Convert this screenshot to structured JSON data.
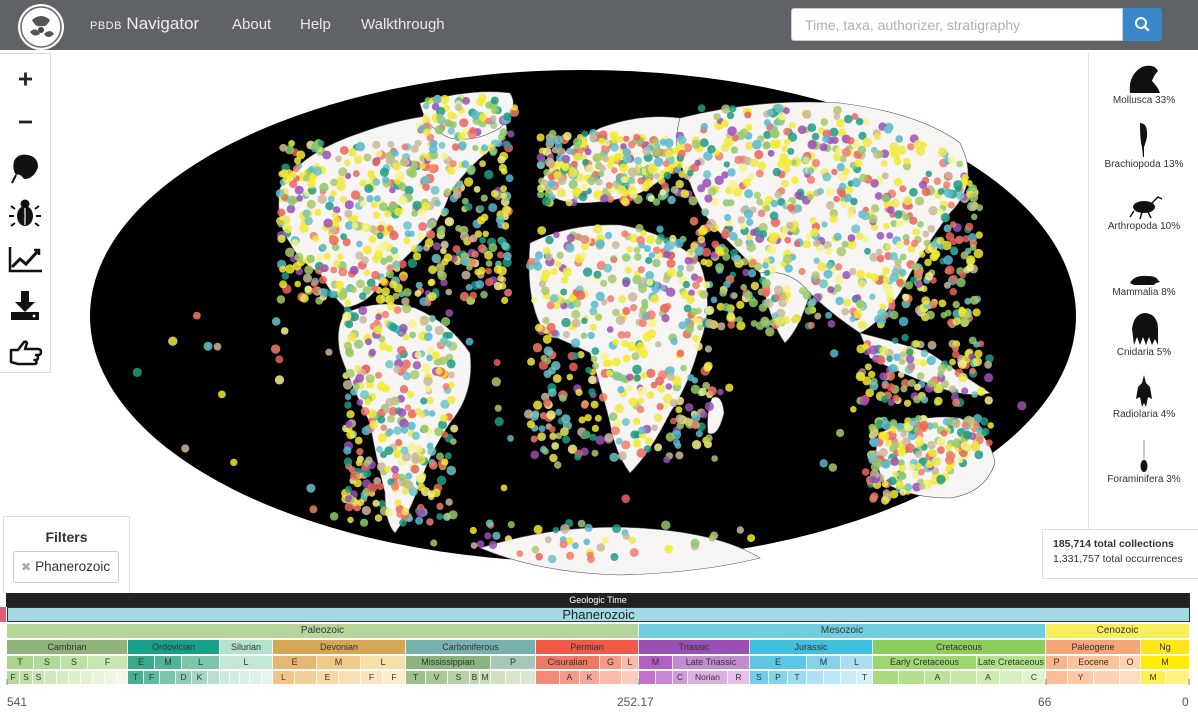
{
  "navbar": {
    "brand_small": "PBDB",
    "brand_big": "Navigator",
    "links": [
      "About",
      "Help",
      "Walkthrough"
    ],
    "search_placeholder": "Time, taxa, authorizer, stratigraphy"
  },
  "toolbar": {
    "tools": [
      "zoom-in",
      "zoom-out",
      "taxa-filter",
      "bug-filter",
      "diversity-chart",
      "download",
      "pointer"
    ]
  },
  "taxa": [
    {
      "label": "Mollusca 33%"
    },
    {
      "label": "Brachiopoda 13%"
    },
    {
      "label": "Arthropoda 10%"
    },
    {
      "label": "Mammalia 8%"
    },
    {
      "label": "Cnidaria 5%"
    },
    {
      "label": "Radiolaria 4%"
    },
    {
      "label": "Foraminifera 3%"
    }
  ],
  "filters": {
    "title": "Filters",
    "active": "Phanerozoic"
  },
  "stats": {
    "collections": "185,714",
    "collections_label": "total collections",
    "occurrences": "1,331,757",
    "occurrences_label": "total occurrences"
  },
  "timeline": {
    "header": "Geologic Time",
    "eon": "Phanerozoic",
    "eras": [
      "Paleozoic",
      "Mesozoic",
      "Cenozoic"
    ],
    "periods": [
      "Cambrian",
      "Ordovician",
      "Silurian",
      "Devonian",
      "Carboniferous",
      "Permian",
      "Triassic",
      "Jurassic",
      "Cretaceous",
      "Paleogene",
      "Ng"
    ],
    "subperiods": [
      "T",
      "S",
      "S",
      "F",
      "E",
      "M",
      "L",
      "L",
      "E",
      "M",
      "L",
      "Mississippian",
      "P",
      "Cisuralian",
      "G",
      "L",
      "M",
      "Late Triassic",
      "E",
      "M",
      "L",
      "Early Cretaceous",
      "Late Cretaceous",
      "P",
      "Eocene",
      "O",
      "M"
    ],
    "stages": [
      "F",
      "S",
      "S",
      "T",
      "F",
      "D",
      "K",
      "L",
      "E",
      "F",
      "F",
      "T",
      "V",
      "S",
      "B",
      "M",
      "A",
      "K",
      "C",
      "Norian",
      "R",
      "S",
      "P",
      "T",
      "T",
      "A",
      "A",
      "C",
      "Y",
      "M"
    ],
    "ticks": [
      "541",
      "252.17",
      "66",
      "0"
    ]
  },
  "colors": {
    "navbar": "#5f6267",
    "accent": "#3a87ca",
    "ocean": "#000000"
  }
}
